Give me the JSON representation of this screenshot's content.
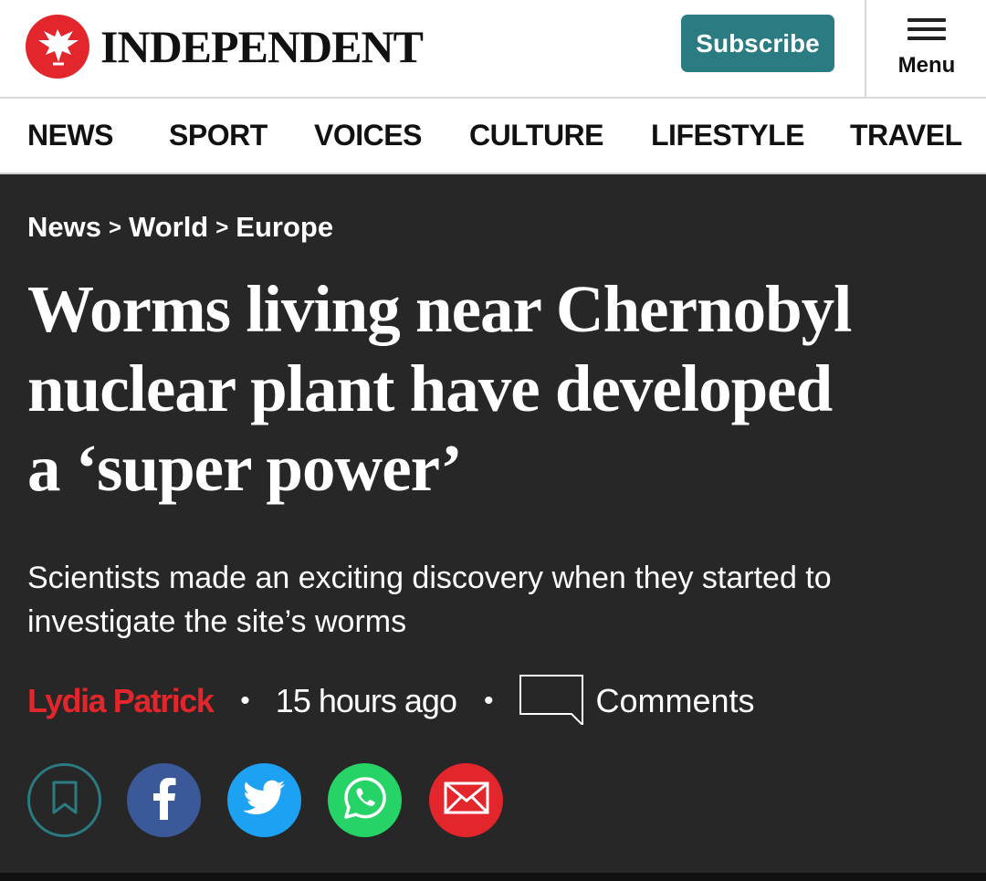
{
  "header": {
    "logo_text": "INDEPENDENT",
    "subscribe_label": "Subscribe",
    "menu_label": "Menu"
  },
  "nav": {
    "items": [
      "NEWS",
      "SPORT",
      "VOICES",
      "CULTURE",
      "LIFESTYLE",
      "TRAVEL"
    ]
  },
  "breadcrumb": {
    "items": [
      "News",
      "World",
      "Europe"
    ],
    "separator": ">"
  },
  "article": {
    "headline_lines": [
      "Worms living near Chernobyl",
      "nuclear plant have developed",
      "a ‘super power’"
    ],
    "standfirst": "Scientists made an exciting discovery when they started to investigate the site’s worms",
    "author": "Lydia Patrick",
    "time": "15 hours ago",
    "bullet": "•",
    "comments_label": "Comments"
  },
  "share": {
    "buttons": [
      {
        "icon": "bookmark-icon",
        "color": "#2a7c82"
      },
      {
        "icon": "facebook-icon",
        "color": "#3b5998"
      },
      {
        "icon": "twitter-icon",
        "color": "#1da1f2"
      },
      {
        "icon": "whatsapp-icon",
        "color": "#25d366"
      },
      {
        "icon": "email-icon",
        "color": "#e3262b"
      }
    ]
  },
  "colors": {
    "brand_red": "#e3262b",
    "subscribe_teal": "#2a7c82",
    "article_bg": "#272727"
  }
}
